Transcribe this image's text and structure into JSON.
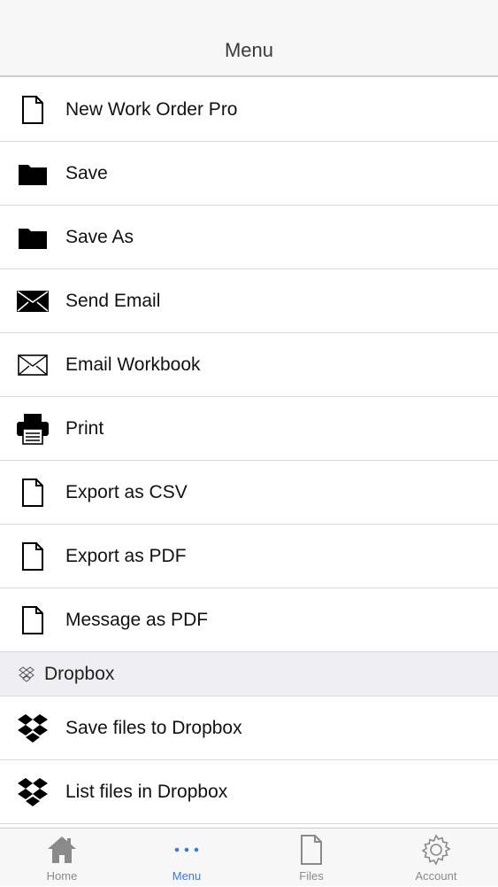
{
  "nav": {
    "title": "Menu"
  },
  "menu_items": [
    {
      "label": "New Work Order Pro",
      "icon": "document-icon"
    },
    {
      "label": "Save",
      "icon": "folder-icon"
    },
    {
      "label": "Save As",
      "icon": "folder-icon"
    },
    {
      "label": "Send Email",
      "icon": "envelope-filled-icon"
    },
    {
      "label": "Email Workbook",
      "icon": "envelope-outline-icon"
    },
    {
      "label": "Print",
      "icon": "printer-icon"
    },
    {
      "label": "Export as CSV",
      "icon": "document-icon"
    },
    {
      "label": "Export as PDF",
      "icon": "document-icon"
    },
    {
      "label": "Message as PDF",
      "icon": "document-icon"
    }
  ],
  "dropbox_section": {
    "header": "Dropbox",
    "items": [
      {
        "label": "Save files to Dropbox",
        "icon": "dropbox-icon"
      },
      {
        "label": "List files in Dropbox",
        "icon": "dropbox-icon"
      }
    ]
  },
  "tabs": [
    {
      "label": "Home",
      "icon": "home-icon",
      "active": false
    },
    {
      "label": "Menu",
      "icon": "more-icon",
      "active": true
    },
    {
      "label": "Files",
      "icon": "file-icon",
      "active": false
    },
    {
      "label": "Account",
      "icon": "gear-icon",
      "active": false
    }
  ],
  "colors": {
    "accent": "#3a7bd5",
    "tab_inactive": "#8a8a8a"
  }
}
